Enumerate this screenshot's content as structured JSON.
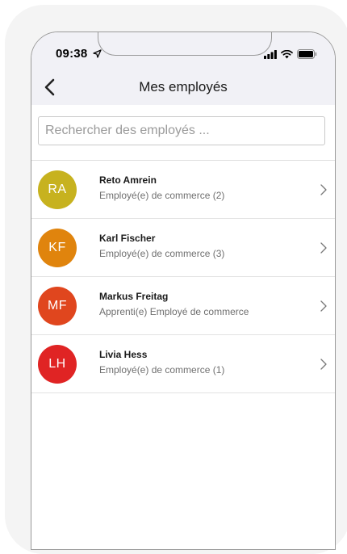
{
  "status_bar": {
    "time": "09:38",
    "icons": [
      "location-arrow-icon",
      "signal-icon",
      "wifi-icon",
      "battery-icon"
    ]
  },
  "header": {
    "title": "Mes employés",
    "back_icon": "chevron-left-icon"
  },
  "search": {
    "placeholder": "Rechercher des employés ..."
  },
  "employees": [
    {
      "initials": "RA",
      "name": "Reto Amrein",
      "role": "Employé(e) de commerce (2)",
      "color": "#c7b21f"
    },
    {
      "initials": "KF",
      "name": "Karl Fischer",
      "role": "Employé(e) de commerce (3)",
      "color": "#e0840d"
    },
    {
      "initials": "MF",
      "name": "Markus Freitag",
      "role": "Apprenti(e) Employé de commerce",
      "color": "#e0461e"
    },
    {
      "initials": "LH",
      "name": "Livia Hess",
      "role": "Employé(e) de commerce (1)",
      "color": "#e02424"
    }
  ]
}
